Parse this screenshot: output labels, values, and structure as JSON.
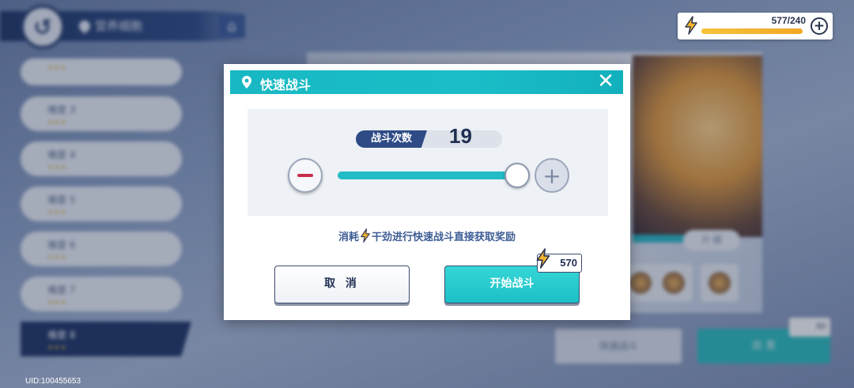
{
  "header": {
    "location_label": "营养细胞",
    "back_icon": "back-arrow-icon",
    "home_icon": "home-icon"
  },
  "energy": {
    "text": "577/240",
    "fill_fraction": 1.0,
    "color": "#f7c33a"
  },
  "stages": [
    {
      "label": ""
    },
    {
      "label": "难度 3"
    },
    {
      "label": "难度 4"
    },
    {
      "label": "难度 5"
    },
    {
      "label": "难度 6"
    },
    {
      "label": "难度 7"
    },
    {
      "label": "难度 8",
      "active": true
    }
  ],
  "uid": "UID:100455653",
  "background_panel": {
    "tab_label": "介 绍",
    "secondary_button": "快速战斗",
    "primary_button": "出 发",
    "cost": "30"
  },
  "modal": {
    "title": "快速战斗",
    "close_icon": "close-icon",
    "count_label": "战斗次数",
    "count_value": "19",
    "slider_fraction": 1.0,
    "description_before": "消耗",
    "description_after": "干劲进行快速战斗直接获取奖励",
    "cancel_label": "取 消",
    "start_label": "开始战斗",
    "cost_value": "570",
    "accent_color": "#1bbec8"
  }
}
